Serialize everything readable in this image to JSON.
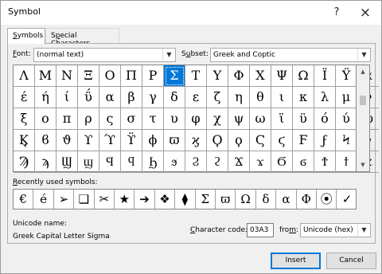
{
  "window": {
    "title": "Symbol",
    "help_glyph": "?",
    "close_glyph": "×"
  },
  "tabs": [
    {
      "label": "Symbols",
      "underline": "S",
      "rest": "ymbols",
      "active": true
    },
    {
      "label": "Special Characters",
      "pre": "S",
      "underline": "p",
      "rest": "ecial Characters",
      "active": false
    }
  ],
  "font": {
    "label_u": "F",
    "label_rest": "ont:",
    "value": "(normal text)"
  },
  "subset": {
    "label_pre": "S",
    "label_u": "u",
    "label_rest": "bset:",
    "value": "Greek and Coptic"
  },
  "grid": {
    "rows": [
      [
        "Λ",
        "Μ",
        "Ν",
        "Ξ",
        "Ο",
        "Π",
        "Ρ",
        "Σ",
        "Τ",
        "Υ",
        "Φ",
        "Χ",
        "Ψ",
        "Ω",
        "Ϊ",
        "Ϋ",
        "ά"
      ],
      [
        "έ",
        "ή",
        "ί",
        "ΰ",
        "α",
        "β",
        "γ",
        "δ",
        "ε",
        "ζ",
        "η",
        "θ",
        "ι",
        "κ",
        "λ",
        "μ",
        "ν"
      ],
      [
        "ξ",
        "ο",
        "π",
        "ρ",
        "ς",
        "σ",
        "τ",
        "υ",
        "φ",
        "χ",
        "ψ",
        "ω",
        "ϊ",
        "ϋ",
        "ό",
        "ύ",
        "ώ"
      ],
      [
        "Ϗ",
        "ϐ",
        "ϑ",
        "ϒ",
        "ϓ",
        "ϔ",
        "ϕ",
        "ϖ",
        "ϗ",
        "Ϙ",
        "ϙ",
        "Ϛ",
        "ϛ",
        "Ϝ",
        "ϝ",
        "Ϟ",
        "ϟ"
      ],
      [
        "Ϡ",
        "ϡ",
        "Ϣ",
        "ϣ",
        "Ϥ",
        "ϥ",
        "Ϧ",
        "ϧ",
        "Ϩ",
        "ϩ",
        "Ϫ",
        "ϫ",
        "Ϭ",
        "ϭ",
        "Ϯ",
        "ϯ",
        "ϰ"
      ]
    ],
    "selected_row": 0,
    "selected_col": 7
  },
  "recent": {
    "label_u": "R",
    "label_rest": "ecently used symbols:",
    "symbols": [
      "€",
      "é",
      "➢",
      "❑",
      "✂",
      "★",
      "➔",
      "❖",
      "⧫",
      "Σ",
      "ϖ",
      "Ω",
      "δ",
      "α",
      "Φ",
      "⦿",
      "✓"
    ]
  },
  "unicode_name": {
    "label": "Unicode name:",
    "value": "Greek Capital Letter Sigma"
  },
  "character_code": {
    "label_u": "C",
    "label_rest": "haracter code:",
    "value": "03A3"
  },
  "from": {
    "label_pre": "fro",
    "label_u": "m",
    "label_rest": ":",
    "value": "Unicode (hex)"
  },
  "buttons": {
    "insert": "Insert",
    "cancel": "Cancel"
  }
}
